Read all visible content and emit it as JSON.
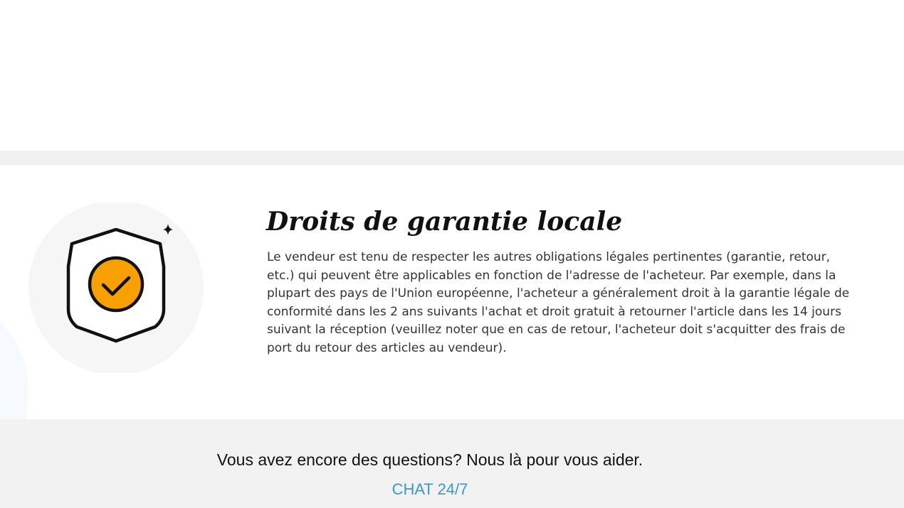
{
  "warranty": {
    "title": "Droits de garantie locale",
    "body": "Le vendeur est tenu de respecter les autres obligations légales pertinentes (garantie, retour, etc.) qui peuvent être applicables en fonction de l'adresse de l'acheteur. Par exemple, dans la plupart des pays de l'Union européenne, l'acheteur a généralement droit à la garantie légale de conformité dans les 2 ans suivants l'achat et droit gratuit à retourner l'article dans les 14 jours suivant la réception (veuillez noter que en cas de retour, l'acheteur doit s'acquitter des frais de port du retour des articles au vendeur).",
    "icon": "shield-check-icon",
    "icon_accent_color": "#f7a000"
  },
  "help": {
    "question": "Vous avez encore des questions? Nous là pour vous aider.",
    "chat_label": "CHAT 24/7",
    "link_color": "#3a9ac6"
  }
}
